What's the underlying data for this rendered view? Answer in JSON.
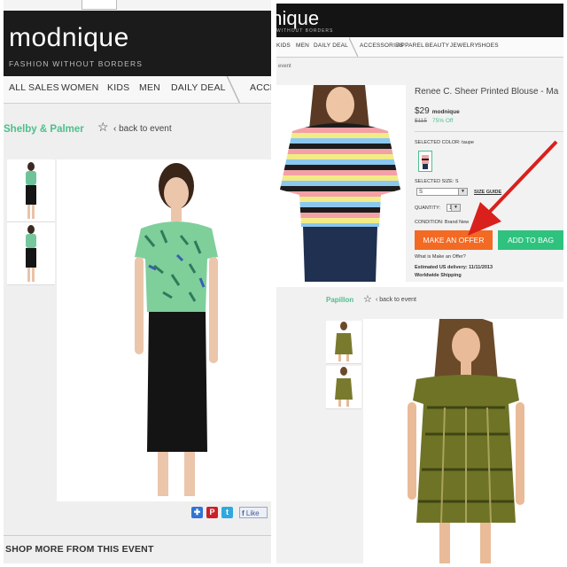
{
  "colors": {
    "accent_green": "#4cc08c",
    "offer_orange": "#f26a23",
    "bag_green": "#2ec27e",
    "arrow_red": "#d9201c"
  },
  "left": {
    "logo": "modnique",
    "tagline": "FASHION WITHOUT BORDERS",
    "nav": [
      "ALL SALES",
      "WOMEN",
      "KIDS",
      "MEN",
      "DAILY DEAL",
      "ACCE"
    ],
    "brand": "Shelby & Palmer",
    "back_link": "back to event",
    "share_icons": [
      "delicious-icon",
      "pinterest-icon",
      "twitter-icon",
      "facebook-icon"
    ],
    "like_label": "Like",
    "shop_more": "SHOP MORE FROM THIS EVENT"
  },
  "right_top": {
    "logo": "dnique",
    "tagline": "WITHOUT BORDERS",
    "nav": [
      "KIDS",
      "MEN",
      "DAILY DEAL",
      "ACCESSORIES",
      "APPAREL",
      "BEAUTY",
      "JEWELRY",
      "SHOES"
    ],
    "event_link": "event",
    "product_title": "Renee C. Sheer Printed Blouse - Ma",
    "price": "$29",
    "price_brand": "modnique",
    "old_price": "$115",
    "discount": "75% Off",
    "selected_color_label": "SELECTED COLOR: taupe",
    "selected_size_label": "SELECTED SIZE: S",
    "size_value": "S",
    "size_guide": "SIZE GUIDE",
    "quantity_label": "QUANTITY:",
    "quantity_value": "1",
    "condition": "CONDITION: Brand New",
    "offer_button": "MAKE AN OFFER",
    "bag_button": "ADD TO BAG",
    "what_is_offer": "What is Make an Offer?",
    "delivery": "Estimated US delivery: 11/11/2013",
    "shipping": "Worldwide Shipping"
  },
  "right_bottom": {
    "brand": "Papillon",
    "back_link": "back to event"
  }
}
